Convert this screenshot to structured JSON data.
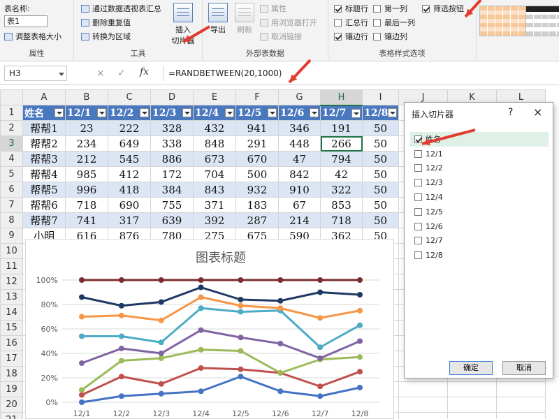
{
  "ribbon": {
    "table_name_label": "表名称:",
    "table_name_value": "表1",
    "resize_table": "调整表格大小",
    "group_properties": "属性",
    "pivot_summary": "通过数据透视表汇总",
    "remove_duplicates": "删除重复值",
    "convert_to_range": "转换为区域",
    "insert_slicer": [
      "插入",
      "切片器"
    ],
    "group_tools": "工具",
    "export": "导出",
    "refresh": "刷新",
    "properties": "属性",
    "open_in_browser": "用浏览器打开",
    "unlink": "取消链接",
    "group_external": "外部表数据",
    "opt_header_row": "标题行",
    "opt_total_row": "汇总行",
    "opt_banded_rows": "镶边行",
    "opt_first_column": "第一列",
    "opt_last_column": "最后一列",
    "opt_banded_columns": "镶边列",
    "opt_filter_button": "筛选按钮",
    "group_style_options": "表格样式选项",
    "opt_states": {
      "header_row": true,
      "total_row": false,
      "banded_rows": true,
      "first_column": false,
      "last_column": false,
      "banded_columns": false,
      "filter_button": true
    }
  },
  "formula_bar": {
    "name_box": "H3",
    "cancel_icon": "×",
    "enter_icon": "✓",
    "fx": "fx",
    "formula": "=RANDBETWEEN(20,1000)"
  },
  "sheet": {
    "columns": [
      "A",
      "B",
      "C",
      "D",
      "E",
      "F",
      "G",
      "H",
      "I",
      "J",
      "K",
      "L"
    ],
    "rows": [
      "1",
      "2",
      "3",
      "4",
      "5",
      "6",
      "7",
      "8",
      "9",
      "10",
      "11",
      "12",
      "13",
      "14",
      "15",
      "16",
      "17",
      "18",
      "19",
      "20",
      "21"
    ],
    "active_column": "H",
    "active_row": "3",
    "header": [
      "姓名",
      "12/1",
      "12/2",
      "12/3",
      "12/4",
      "12/5",
      "12/6",
      "12/7",
      "12/8"
    ],
    "data": [
      [
        "帮帮1",
        "23",
        "222",
        "328",
        "432",
        "941",
        "346",
        "191",
        "50"
      ],
      [
        "帮帮2",
        "234",
        "649",
        "338",
        "848",
        "291",
        "448",
        "266",
        "50"
      ],
      [
        "帮帮3",
        "212",
        "545",
        "886",
        "673",
        "670",
        "47",
        "794",
        "50"
      ],
      [
        "帮帮4",
        "985",
        "412",
        "172",
        "704",
        "500",
        "842",
        "42",
        "50"
      ],
      [
        "帮帮5",
        "996",
        "418",
        "384",
        "843",
        "932",
        "910",
        "322",
        "50"
      ],
      [
        "帮帮6",
        "718",
        "690",
        "755",
        "371",
        "183",
        "67",
        "853",
        "50"
      ],
      [
        "帮帮7",
        "741",
        "317",
        "639",
        "392",
        "287",
        "214",
        "718",
        "50"
      ],
      [
        "小明",
        "616",
        "876",
        "780",
        "275",
        "675",
        "590",
        "362",
        "50"
      ]
    ]
  },
  "chart_data": {
    "type": "line",
    "title": "图表标题",
    "categories": [
      "12/1",
      "12/2",
      "12/3",
      "12/4",
      "12/5",
      "12/6",
      "12/7",
      "12/8"
    ],
    "y_ticks": [
      "0%",
      "20%",
      "40%",
      "60%",
      "80%",
      "100%"
    ],
    "ylim": [
      0,
      1
    ],
    "stacked_percent": true,
    "grid": true,
    "series": [
      {
        "color": "#4472c4",
        "values": [
          0.0,
          0.05,
          0.07,
          0.09,
          0.21,
          0.09,
          0.05,
          0.12
        ]
      },
      {
        "color": "#c0504d",
        "values": [
          0.06,
          0.21,
          0.15,
          0.28,
          0.27,
          0.24,
          0.13,
          0.25
        ]
      },
      {
        "color": "#9bbb59",
        "values": [
          0.1,
          0.34,
          0.36,
          0.43,
          0.42,
          0.24,
          0.35,
          0.37
        ]
      },
      {
        "color": "#8064a2",
        "values": [
          0.32,
          0.44,
          0.4,
          0.59,
          0.53,
          0.48,
          0.36,
          0.5
        ]
      },
      {
        "color": "#4bacc6",
        "values": [
          0.54,
          0.54,
          0.49,
          0.77,
          0.74,
          0.75,
          0.45,
          0.63
        ]
      },
      {
        "color": "#f79646",
        "values": [
          0.7,
          0.71,
          0.67,
          0.86,
          0.79,
          0.77,
          0.69,
          0.75
        ]
      },
      {
        "color": "#1f3864",
        "values": [
          0.86,
          0.79,
          0.82,
          0.94,
          0.84,
          0.83,
          0.9,
          0.88
        ]
      },
      {
        "color": "#7b2c2c",
        "values": [
          1.0,
          1.0,
          1.0,
          1.0,
          1.0,
          1.0,
          1.0,
          1.0
        ]
      }
    ]
  },
  "dialog": {
    "title": "插入切片器",
    "help": "?",
    "close": "×",
    "fields": [
      {
        "label": "姓名",
        "checked": true
      },
      {
        "label": "12/1",
        "checked": false
      },
      {
        "label": "12/2",
        "checked": false
      },
      {
        "label": "12/3",
        "checked": false
      },
      {
        "label": "12/4",
        "checked": false
      },
      {
        "label": "12/5",
        "checked": false
      },
      {
        "label": "12/6",
        "checked": false
      },
      {
        "label": "12/7",
        "checked": false
      },
      {
        "label": "12/8",
        "checked": false
      }
    ],
    "ok": "确定",
    "cancel": "取消"
  },
  "colors": {
    "accent_green": "#217346",
    "table_header": "#4a78bf",
    "band": "#dbe5f3",
    "arrow_red": "#e23b30"
  }
}
